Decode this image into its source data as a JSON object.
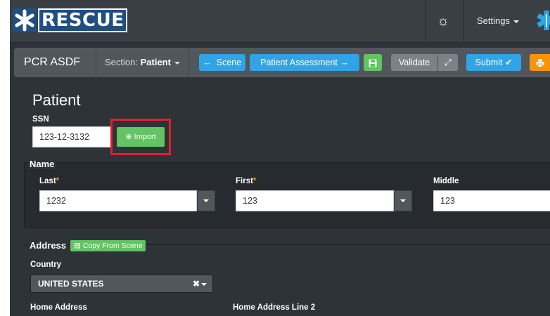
{
  "navbar": {
    "logo_text": "RESCUE",
    "settings_label": "Settings"
  },
  "toolbar": {
    "title": "PCR ASDF",
    "section_prefix": "Section:",
    "section_value": "Patient",
    "scene_label": "Scene",
    "assessment_label": "Patient Assessment →",
    "validate_label": "Validate",
    "submit_label": "Submit ✔"
  },
  "patient": {
    "heading": "Patient",
    "ssn_label": "SSN",
    "ssn_value": "123-12-3132",
    "import_label": "⊕ Import"
  },
  "name_section": {
    "legend": "Name",
    "last_label": "Last",
    "last_value": "1232",
    "first_label": "First",
    "first_value": "123",
    "middle_label": "Middle",
    "middle_value": "123",
    "required_mark": "*"
  },
  "address_section": {
    "legend": "Address",
    "copy_label": "Copy From Scene",
    "country_label": "Country",
    "country_value": "UNITED STATES",
    "home_address_label": "Home Address",
    "home_address2_label": "Home Address Line 2"
  },
  "colors": {
    "accent_blue": "#2fa4e7",
    "success_green": "#62c462",
    "warning_orange": "#f89406",
    "highlight_red": "#e0202a"
  }
}
